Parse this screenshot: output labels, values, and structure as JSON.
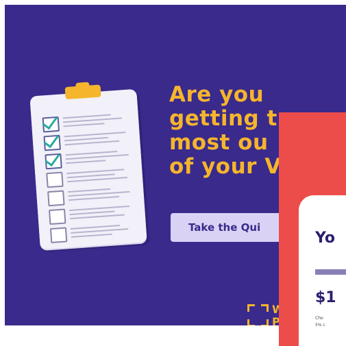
{
  "ad": {
    "headline": [
      "Are you",
      "getting t",
      "most ou",
      "of your V"
    ],
    "cta_label": "Take the Qui",
    "logo": {
      "letter_top": "W",
      "letter_bottom": "P"
    },
    "colors": {
      "background": "#3a2a8c",
      "accent": "#f5b52c",
      "button": "#d9d2f5",
      "check": "#2aa9a0"
    },
    "checklist": [
      {
        "checked": true
      },
      {
        "checked": true
      },
      {
        "checked": true
      },
      {
        "checked": false
      },
      {
        "checked": false
      },
      {
        "checked": false
      },
      {
        "checked": false
      }
    ]
  },
  "overlay": {
    "title": "Yo",
    "price": "$1",
    "text_lines": [
      "Cho",
      "5% c"
    ],
    "colors": {
      "background": "#ec4d4a",
      "panel": "#ffffff"
    }
  }
}
